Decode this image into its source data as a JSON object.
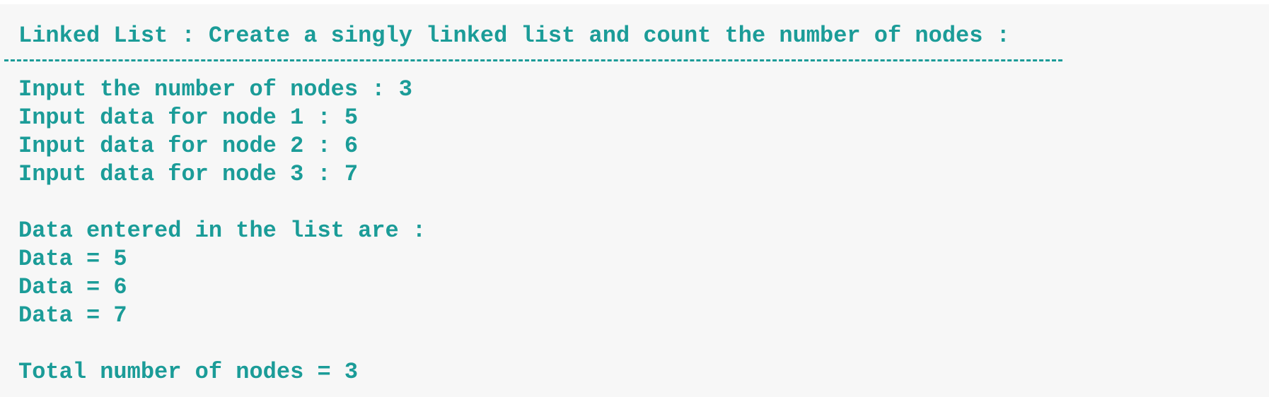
{
  "title": "Linked List : Create a singly linked list and count the number of nodes :",
  "separator": "-------------------------------------------------------------------------------",
  "input_prompts": [
    "Input the number of nodes : 3",
    "Input data for node 1 : 5",
    "Input data for node 2 : 6",
    "Input data for node 3 : 7"
  ],
  "list_header": "Data entered in the list are :",
  "data_lines": [
    "Data = 5",
    "Data = 6",
    "Data = 7"
  ],
  "total": "Total number of nodes = 3",
  "colors": {
    "text": "#1b9c98",
    "background": "#f7f7f7"
  }
}
